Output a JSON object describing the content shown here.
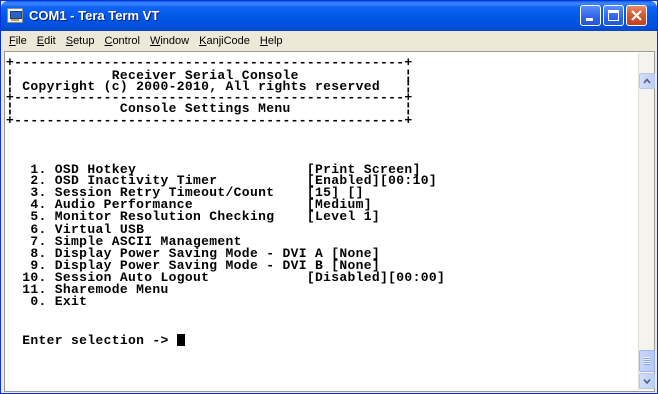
{
  "window": {
    "title": "COM1 - Tera Term VT",
    "controls": {
      "minimize_icon": "minimize-icon",
      "maximize_icon": "maximize-icon",
      "close_icon": "close-icon"
    }
  },
  "menubar": {
    "items": [
      {
        "label": "File",
        "accel": "F",
        "rest": "ile"
      },
      {
        "label": "Edit",
        "accel": "E",
        "rest": "dit"
      },
      {
        "label": "Setup",
        "accel": "S",
        "rest": "etup"
      },
      {
        "label": "Control",
        "accel": "C",
        "rest": "ontrol"
      },
      {
        "label": "Window",
        "accel": "W",
        "rest": "indow"
      },
      {
        "label": "KanjiCode",
        "accel": "K",
        "rest": "anjiCode"
      },
      {
        "label": "Help",
        "accel": "H",
        "rest": "elp"
      }
    ]
  },
  "terminal": {
    "lines": [
      "+------------------------------------------------+",
      "¦            Receiver Serial Console             ¦",
      "¦ Copyright (c) 2000-2010, All rights reserved   ¦",
      "+------------------------------------------------+",
      "¦             Console Settings Menu              ¦",
      "+------------------------------------------------+",
      "",
      "",
      "   1. OSD Hotkey                     [Print Screen]",
      "   2. OSD Inactivity Timer           [Enabled][00:10]",
      "   3. Session Retry Timeout/Count    [15] []",
      "   4. Audio Performance              [Medium]",
      "   5. Monitor Resolution Checking    [Level 1]",
      "   6. Virtual USB",
      "   7. Simple ASCII Management",
      "   8. Display Power Saving Mode - DVI A [None]",
      "   9. Display Power Saving Mode - DVI B [None]",
      "  10. Session Auto Logout            [Disabled][00:00]",
      "  11. Sharemode Menu",
      "   0. Exit",
      "",
      "  Enter selection -> "
    ]
  },
  "colors": {
    "titlebar": "#0054E3",
    "terminal_bg": "#FFFFFF",
    "terminal_fg": "#000000",
    "window_bg": "#ECE9D8"
  }
}
